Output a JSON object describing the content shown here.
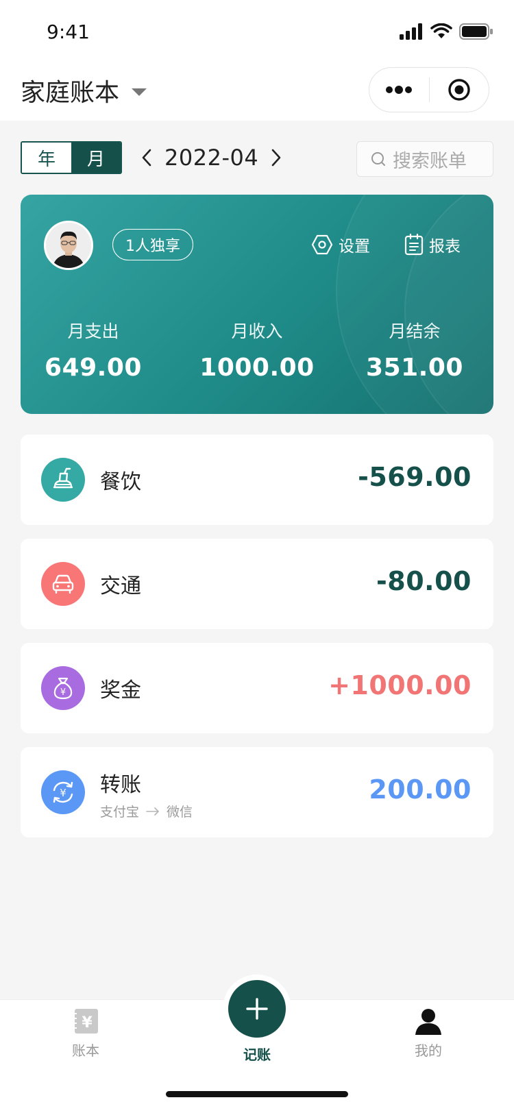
{
  "status_bar": {
    "time": "9:41"
  },
  "title_bar": {
    "title": "家庭账本"
  },
  "toolbar": {
    "year_label": "年",
    "month_label": "月",
    "date": "2022-04",
    "search_placeholder": "搜索账单"
  },
  "summary": {
    "share_badge": "1人独享",
    "settings_label": "设置",
    "report_label": "报表",
    "stats": [
      {
        "label": "月支出",
        "value": "649.00"
      },
      {
        "label": "月收入",
        "value": "1000.00"
      },
      {
        "label": "月结余",
        "value": "351.00"
      }
    ]
  },
  "records": [
    {
      "name": "餐饮",
      "amount": "-569.00",
      "icon": "dining-icon",
      "icon_color": "#35a9a4",
      "amount_color": "#15504b"
    },
    {
      "name": "交通",
      "amount": "-80.00",
      "icon": "car-icon",
      "icon_color": "#f87676",
      "amount_color": "#15504b"
    },
    {
      "name": "奖金",
      "amount": "+1000.00",
      "icon": "money-bag-icon",
      "icon_color": "#a86be0",
      "amount_color": "#f07574"
    },
    {
      "name": "转账",
      "amount": "200.00",
      "icon": "transfer-icon",
      "icon_color": "#5b97f5",
      "amount_color": "#5b97f5",
      "from": "支付宝",
      "to": "微信"
    }
  ],
  "tab_bar": {
    "ledger_label": "账本",
    "add_label": "记账",
    "mine_label": "我的"
  },
  "colors": {
    "brand_dark": "#15504b",
    "card_gradient_start": "#35a4a2",
    "card_gradient_end": "#15716f"
  }
}
